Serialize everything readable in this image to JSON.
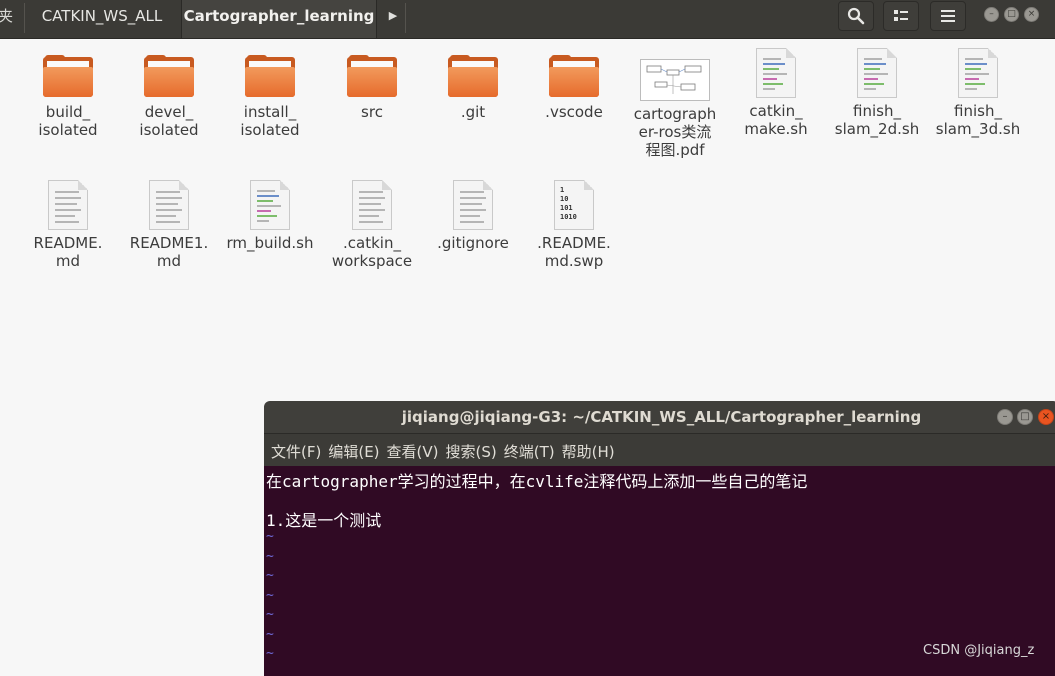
{
  "file_manager": {
    "tabs": [
      {
        "label": "夹"
      },
      {
        "label": "CATKIN_WS_ALL"
      },
      {
        "label": "Cartographer_learning"
      }
    ],
    "icons": {
      "search": "search-icon",
      "view": "view-toggle-icon",
      "menu": "hamburger-menu-icon"
    },
    "items": [
      {
        "l1": "build_",
        "l2": "isolated",
        "l3": ""
      },
      {
        "l1": "devel_",
        "l2": "isolated",
        "l3": ""
      },
      {
        "l1": "install_",
        "l2": "isolated",
        "l3": ""
      },
      {
        "l1": "src",
        "l2": "",
        "l3": ""
      },
      {
        "l1": ".git",
        "l2": "",
        "l3": ""
      },
      {
        "l1": ".vscode",
        "l2": "",
        "l3": ""
      },
      {
        "l1": "cartograph",
        "l2": "er-ros类流",
        "l3": "程图.pdf"
      },
      {
        "l1": "catkin_",
        "l2": "make.sh",
        "l3": ""
      },
      {
        "l1": "finish_",
        "l2": "slam_2d.sh",
        "l3": ""
      },
      {
        "l1": "finish_",
        "l2": "slam_3d.sh",
        "l3": ""
      },
      {
        "l1": "README.",
        "l2": "md",
        "l3": ""
      },
      {
        "l1": "README1.",
        "l2": "md",
        "l3": ""
      },
      {
        "l1": "rm_build.sh",
        "l2": "",
        "l3": ""
      },
      {
        "l1": ".catkin_",
        "l2": "workspace",
        "l3": ""
      },
      {
        "l1": ".gitignore",
        "l2": "",
        "l3": ""
      },
      {
        "l1": ".README.",
        "l2": "md.swp",
        "l3": ""
      }
    ],
    "binary_glyph": [
      "1",
      "10",
      "101",
      "1010"
    ]
  },
  "terminal": {
    "title": "jiqiang@jiqiang-G3: ~/CATKIN_WS_ALL/Cartographer_learning",
    "menu": [
      "文件(F)",
      "编辑(E)",
      "查看(V)",
      "搜索(S)",
      "终端(T)",
      "帮助(H)"
    ],
    "lines": [
      "在cartographer学习的过程中，在cvlife注释代码上添加一些自己的笔记",
      "1.这是一个测试"
    ],
    "tilde": "~",
    "colors": {
      "background": "#300a24",
      "tilde": "#6f6ad8",
      "close": "#e95420"
    }
  },
  "watermark": "CSDN @Jiqiang_z"
}
